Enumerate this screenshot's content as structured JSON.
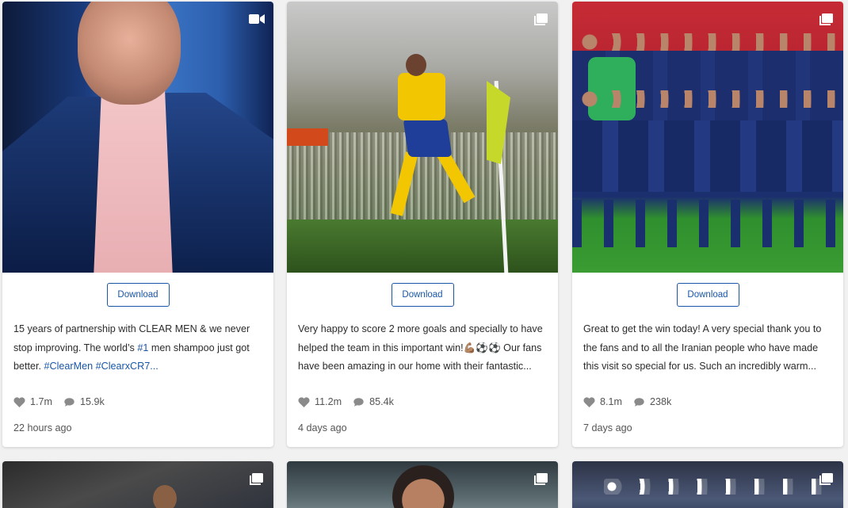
{
  "colors": {
    "link": "#1a56a8",
    "background": "#f1f1f1"
  },
  "posts": [
    {
      "media_type": "video-icon",
      "download_label": "Download",
      "caption_segments": [
        "15 years of partnership with CLEAR MEN & we never stop improving. The world’s ",
        "#1",
        " men shampoo just got better. ",
        "#ClearMen",
        " ",
        "#ClearxCR7..."
      ],
      "likes": "1.7m",
      "comments": "15.9k",
      "time": "22 hours ago"
    },
    {
      "media_type": "carousel-icon",
      "download_label": "Download",
      "caption": "Very happy to score 2 more goals and specially to have helped the team in this important win!💪🏽⚽⚽ Our fans have been amazing in our home with their fantastic...",
      "likes": "11.2m",
      "comments": "85.4k",
      "time": "4 days ago"
    },
    {
      "media_type": "carousel-icon",
      "download_label": "Download",
      "caption": "Great to get the win today! A very special thank you to the fans and to all the Iranian people who have made this visit so special for us. Such an incredibly warm...",
      "likes": "8.1m",
      "comments": "238k",
      "time": "7 days ago"
    },
    {
      "media_type": "carousel-icon"
    },
    {
      "media_type": "carousel-icon"
    },
    {
      "media_type": "carousel-icon"
    }
  ]
}
